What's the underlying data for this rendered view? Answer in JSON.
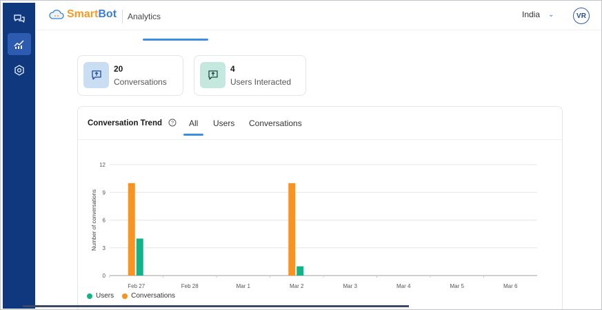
{
  "header": {
    "logo_text_1": "Smart",
    "logo_text_2": "Bot",
    "title": "Analytics",
    "region": "India",
    "avatar_initials": "VR"
  },
  "sidebar": {
    "items": [
      {
        "name": "chats-icon",
        "active": false
      },
      {
        "name": "analytics-icon",
        "active": true
      },
      {
        "name": "settings-icon",
        "active": false
      }
    ]
  },
  "stats": [
    {
      "value": "20",
      "label": "Conversations"
    },
    {
      "value": "4",
      "label": "Users Interacted"
    }
  ],
  "trend": {
    "title": "Conversation Trend",
    "tabs": [
      "All",
      "Users",
      "Conversations"
    ],
    "active_tab": "All"
  },
  "chart_data": {
    "type": "bar",
    "categories": [
      "Feb 27",
      "Feb 28",
      "Mar 1",
      "Mar 2",
      "Mar 3",
      "Mar 4",
      "Mar 5",
      "Mar 6"
    ],
    "series": [
      {
        "name": "Conversations",
        "color": "#f7931e",
        "values": [
          10,
          0,
          0,
          10,
          0,
          0,
          0,
          0
        ]
      },
      {
        "name": "Users",
        "color": "#13b38a",
        "values": [
          4,
          0,
          0,
          1,
          0,
          0,
          0,
          0
        ]
      }
    ],
    "ylabel": "Number of conversations",
    "ylim": [
      0,
      12
    ],
    "yticks": [
      0,
      3,
      6,
      9,
      12
    ],
    "grid": true,
    "legend_position": "bottom-left",
    "legend": [
      "Users",
      "Conversations"
    ]
  },
  "colors": {
    "sidebar": "#10387f",
    "accent": "#3d8de0",
    "conversations": "#f7931e",
    "users": "#13b38a"
  }
}
